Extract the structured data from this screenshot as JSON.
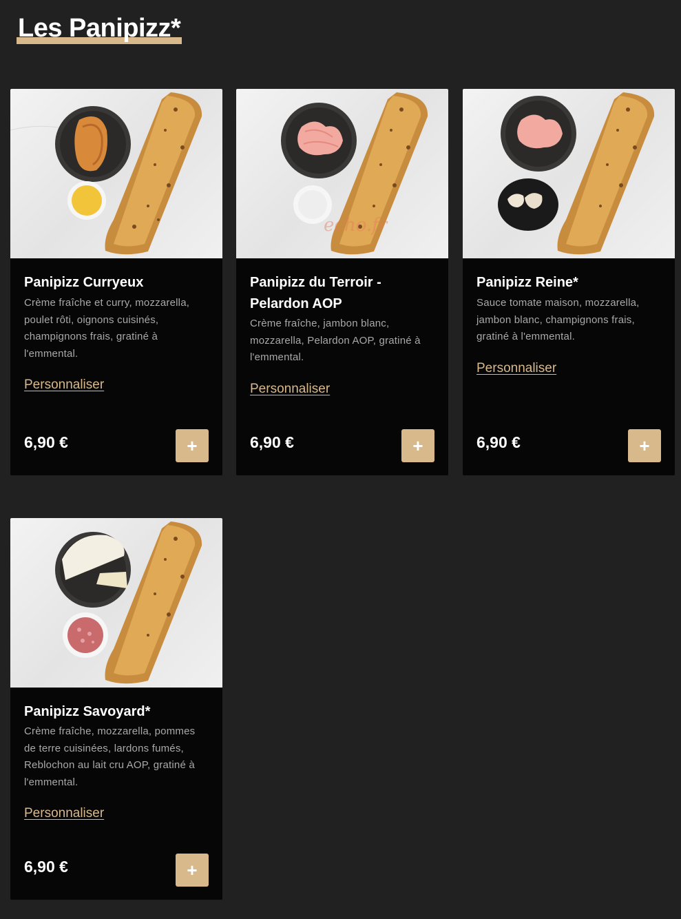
{
  "section": {
    "title": "Les Panipizz*"
  },
  "products": [
    {
      "name": "Panipizz Curryeux",
      "description": "Crème fraîche et curry, mozzarella, poulet rôti, oignons cuisinés, champignons frais, gratiné à l'emmental.",
      "customize_label": "Personnaliser",
      "price": "6,90 €",
      "add_label": "+"
    },
    {
      "name": "Panipizz du Terroir - Pelardon AOP",
      "description": "Crème fraîche, jambon blanc, mozzarella, Pelardon AOP, gratiné à l'emmental.",
      "customize_label": "Personnaliser",
      "price": "6,90 €",
      "add_label": "+"
    },
    {
      "name": "Panipizz Reine*",
      "description": "Sauce tomate maison, mozzarella, jambon blanc, champignons frais, gratiné à l'emmental.",
      "customize_label": "Personnaliser",
      "price": "6,90 €",
      "add_label": "+"
    },
    {
      "name": "Panipizz Savoyard*",
      "description": "Crème fraîche, mozzarella, pommes de terre cuisinées, lardons fumés, Reblochon au lait cru AOP, gratiné à l'emmental.",
      "customize_label": "Personnaliser",
      "price": "6,90 €",
      "add_label": "+"
    }
  ],
  "watermark": "echo.fr",
  "colors": {
    "background": "#212121",
    "card": "#060606",
    "accent": "#d8b98c",
    "description": "#a9a9a9"
  }
}
